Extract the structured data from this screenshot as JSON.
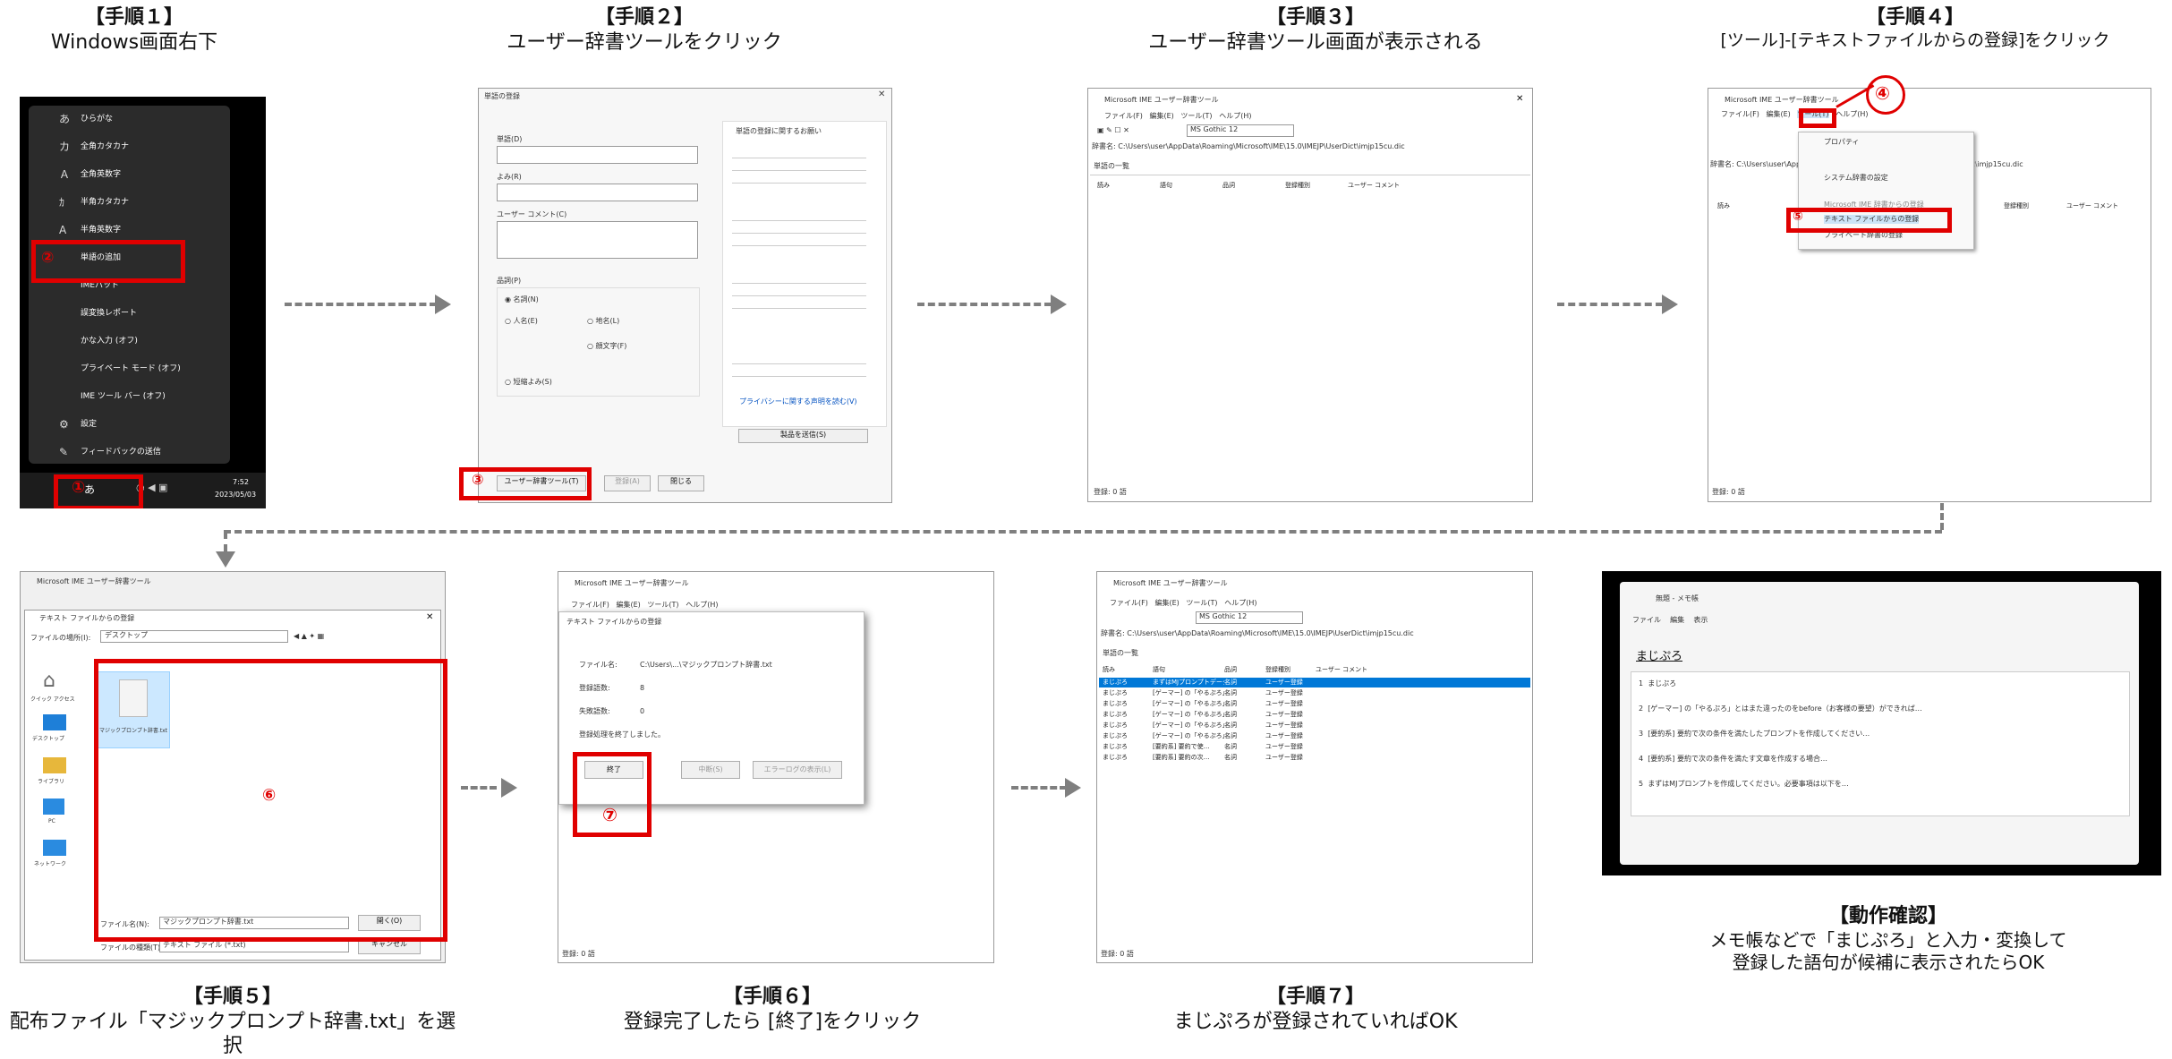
{
  "steps": {
    "s1": {
      "title": "【手順１】",
      "sub": "Windows画面右下"
    },
    "s2": {
      "title": "【手順２】",
      "sub": "ユーザー辞書ツールをクリック"
    },
    "s3": {
      "title": "【手順３】",
      "sub": "ユーザー辞書ツール画面が表示される"
    },
    "s4": {
      "title": "【手順４】",
      "sub": "[ツール]-[テキストファイルからの登録]をクリック"
    },
    "s5": {
      "title": "【手順５】",
      "sub": "配布ファイル「マジックプロンプト辞書.txt」を選択"
    },
    "s6": {
      "title": "【手順６】",
      "sub": "登録完了したら [終了]をクリック"
    },
    "s7": {
      "title": "【手順７】",
      "sub": "まじぷろが登録されていればOK"
    },
    "check": {
      "title": "【動作確認】",
      "line1": "メモ帳などで「まじぷろ」と入力・変換して",
      "line2": "登録した語句が候補に表示されたらOK"
    }
  },
  "markers": [
    "①",
    "②",
    "③",
    "④",
    "⑤",
    "⑥",
    "⑦"
  ],
  "p1": {
    "menu": [
      "ひらがな",
      "全角カタカナ",
      "全角英数字",
      "半角カタカナ",
      "半角英数字",
      "単語の追加",
      "IMEパッド",
      "誤変換レポート",
      "かな入力 (オフ)",
      "プライベート モード (オフ)",
      "IME ツール バー (オフ)",
      "設定",
      "フィードバックの送信"
    ],
    "time": "7:52",
    "date": "2023/05/03"
  },
  "p2": {
    "title": "単語の登録",
    "fields": [
      "単語(D)",
      "よみ(R)",
      "ユーザー コメント(C)",
      "品詞(P)"
    ],
    "pos": [
      "名詞(N)",
      "人名(E)",
      "地名(L)",
      "顔文字(F)",
      "短縮よみ(S)"
    ],
    "right_title": "単語の登録に関するお願い",
    "buttons": [
      "ユーザー辞書ツール(T)",
      "登録(A)",
      "閉じる"
    ],
    "link": "プライバシーに関する声明を読む(V)",
    "send": "製品を送信(S)"
  },
  "p3": {
    "title": "Microsoft IME ユーザー辞書ツール",
    "menu": [
      "ファイル(F)",
      "編集(E)",
      "ツール(T)",
      "ヘルプ(H)"
    ],
    "font": "MS Gothic 12",
    "path": "辞書名: C:\\Users\\user\\AppData\\Roaming\\Microsoft\\IME\\15.0\\IMEJP\\UserDict\\imjp15cu.dic",
    "list_label": "単語の一覧",
    "cols": [
      "読み",
      "語句",
      "品詞",
      "登録種別",
      "ユーザー コメント"
    ],
    "status": "登録: 0 語"
  },
  "p4": {
    "menu_items": [
      "プロパティ",
      "システム辞書の設定",
      "テキスト ファイルからの登録",
      "Microsoft IME 辞書からの登録",
      "プライベート辞書の登録"
    ]
  },
  "p5": {
    "title": "テキスト ファイルからの登録",
    "location_label": "ファイルの場所(I):",
    "location": "デスクトップ",
    "file": "マジックプロンプト辞書.txt",
    "side": [
      "クイック アクセス",
      "デスクトップ",
      "ライブラリ",
      "PC",
      "ネットワーク"
    ],
    "filename_label": "ファイル名(N):",
    "filename": "マジックプロンプト辞書.txt",
    "type_label": "ファイルの種類(T):",
    "type": "テキスト ファイル (*.txt)",
    "open": "開く(O)",
    "cancel": "キャンセル"
  },
  "p6": {
    "dialog_title": "テキスト ファイルからの登録",
    "rows": [
      [
        "ファイル名:",
        "C:\\Users\\...\\マジックプロンプト辞書.txt"
      ],
      [
        "登録語数:",
        "8"
      ],
      [
        "失敗語数:",
        "0"
      ]
    ],
    "done": "登録処理を終了しました。",
    "buttons": [
      "終了",
      "中断(S)",
      "エラーログの表示(L)"
    ]
  },
  "p7": {
    "rows": [
      [
        "まじぷろ",
        "まずはMJプロンプトデータ",
        "名詞",
        "ユーザー登録",
        ""
      ],
      [
        "まじぷろ",
        "[ゲーマー] の「やるぷろ」",
        "名詞",
        "ユーザー登録",
        ""
      ],
      [
        "まじぷろ",
        "[ゲーマー] の「やるぷろ」",
        "名詞",
        "ユーザー登録",
        ""
      ],
      [
        "まじぷろ",
        "[ゲーマー] の「やるぷろ」",
        "名詞",
        "ユーザー登録",
        ""
      ],
      [
        "まじぷろ",
        "[ゲーマー] の「やるぷろ」",
        "名詞",
        "ユーザー登録",
        ""
      ],
      [
        "まじぷろ",
        "[ゲーマー] の「やるぷろ」",
        "名詞",
        "ユーザー登録",
        ""
      ],
      [
        "まじぷろ",
        "[要約系] 要約で使…",
        "名詞",
        "ユーザー登録",
        ""
      ],
      [
        "まじぷろ",
        "[要約系] 要約の次…",
        "名詞",
        "ユーザー登録",
        ""
      ]
    ]
  },
  "p8": {
    "title": "無題 - メモ帳",
    "menu": [
      "ファイル",
      "編集",
      "表示"
    ],
    "typed": "まじぷろ",
    "candidates": [
      "まじぷろ",
      "[ゲーマー] の「やるぷろ」とはまた違ったのをbefore（お客様の要望）ができれば…",
      "[要約系] 要約で次の条件を満たしたプロンプトを作成してください…",
      "[要約系] 要約で次の条件を満たす文章を作成する場合…",
      "まずはMJプロンプトを作成してください。必要事項は以下を…"
    ]
  },
  "colors": {
    "accent_red": "#e00000",
    "arrow_gray": "#7f7f7f",
    "selection_blue": "#0078d7"
  }
}
